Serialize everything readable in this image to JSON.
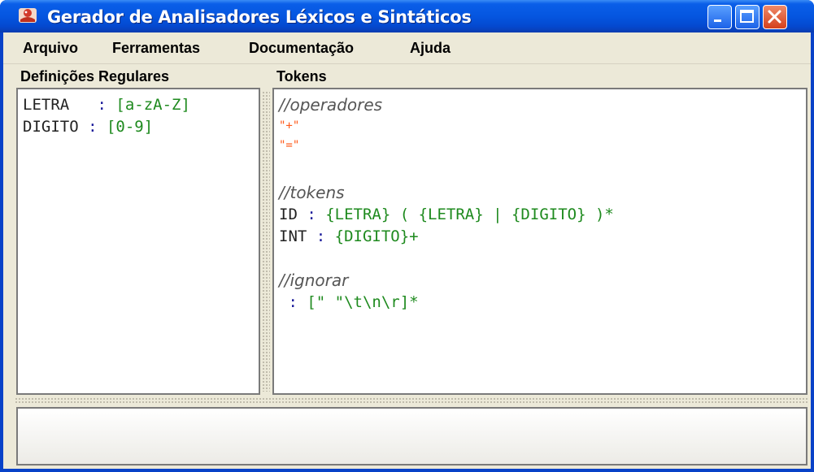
{
  "window": {
    "title": "Gerador de Analisadores Léxicos e Sintáticos"
  },
  "menu": [
    "Arquivo",
    "Ferramentas",
    "Documentação",
    "Ajuda"
  ],
  "regular_definitions": {
    "header": "Definições Regulares",
    "lines": [
      {
        "name": "LETRA  ",
        "sep": " : ",
        "value": "[a-zA-Z]"
      },
      {
        "name": "DIGITO ",
        "sep": ": ",
        "value": "[0-9]"
      }
    ]
  },
  "tokens": {
    "header": "Tokens",
    "comment_operators": "//operadores",
    "op_plus": "\"+\"",
    "op_eq": "\"=\"",
    "comment_tokens": "//tokens",
    "id_name": "ID",
    "id_sep": " : ",
    "id_def": "{LETRA} ( {LETRA} | {DIGITO} )*",
    "int_name": "INT",
    "int_sep": " : ",
    "int_def": "{DIGITO}+",
    "comment_ignore": "//ignorar",
    "ignore_sep": " : ",
    "ignore_def": "[\" \"\\t\\n\\r]*"
  },
  "colors": {
    "title_bar": "#0556e0",
    "keyword": "#1e8a1e",
    "string": "#ff5a1a",
    "separator": "#1a1a9a"
  }
}
